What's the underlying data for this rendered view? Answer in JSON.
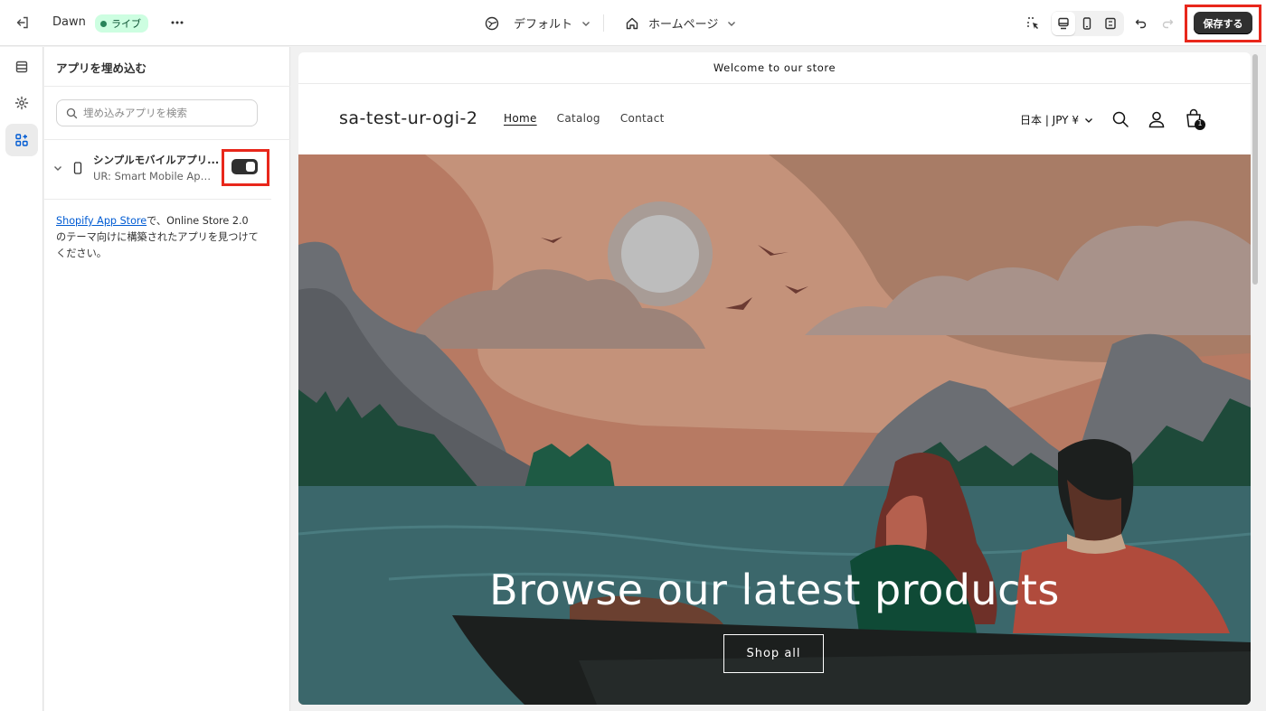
{
  "topbar": {
    "theme_name": "Dawn",
    "live_badge": "ライブ",
    "template_menu": "デフォルト",
    "page_menu": "ホームページ",
    "save_label": "保存する"
  },
  "panel": {
    "title": "アプリを埋め込む",
    "search_placeholder": "埋め込みアプリを検索",
    "app": {
      "name": "シンプルモバイルアプリ...",
      "subtitle": "UR: Smart Mobile App ...",
      "enabled": true
    },
    "help": {
      "link_text": "Shopify App Store",
      "text": "で、Online Store 2.0 のテーマ向けに構築されたアプリを見つけてください。"
    }
  },
  "preview": {
    "announcement": "Welcome to our store",
    "store_name": "sa-test-ur-ogi-2",
    "nav": [
      "Home",
      "Catalog",
      "Contact"
    ],
    "locale": "日本 | JPY ¥",
    "cart_count": "1",
    "hero_title": "Browse our latest products",
    "hero_button": "Shop all"
  },
  "colors": {
    "highlight": "#e8271b",
    "save_button": "#303030",
    "live_badge_bg": "#cdfee1",
    "link": "#005bd3"
  }
}
